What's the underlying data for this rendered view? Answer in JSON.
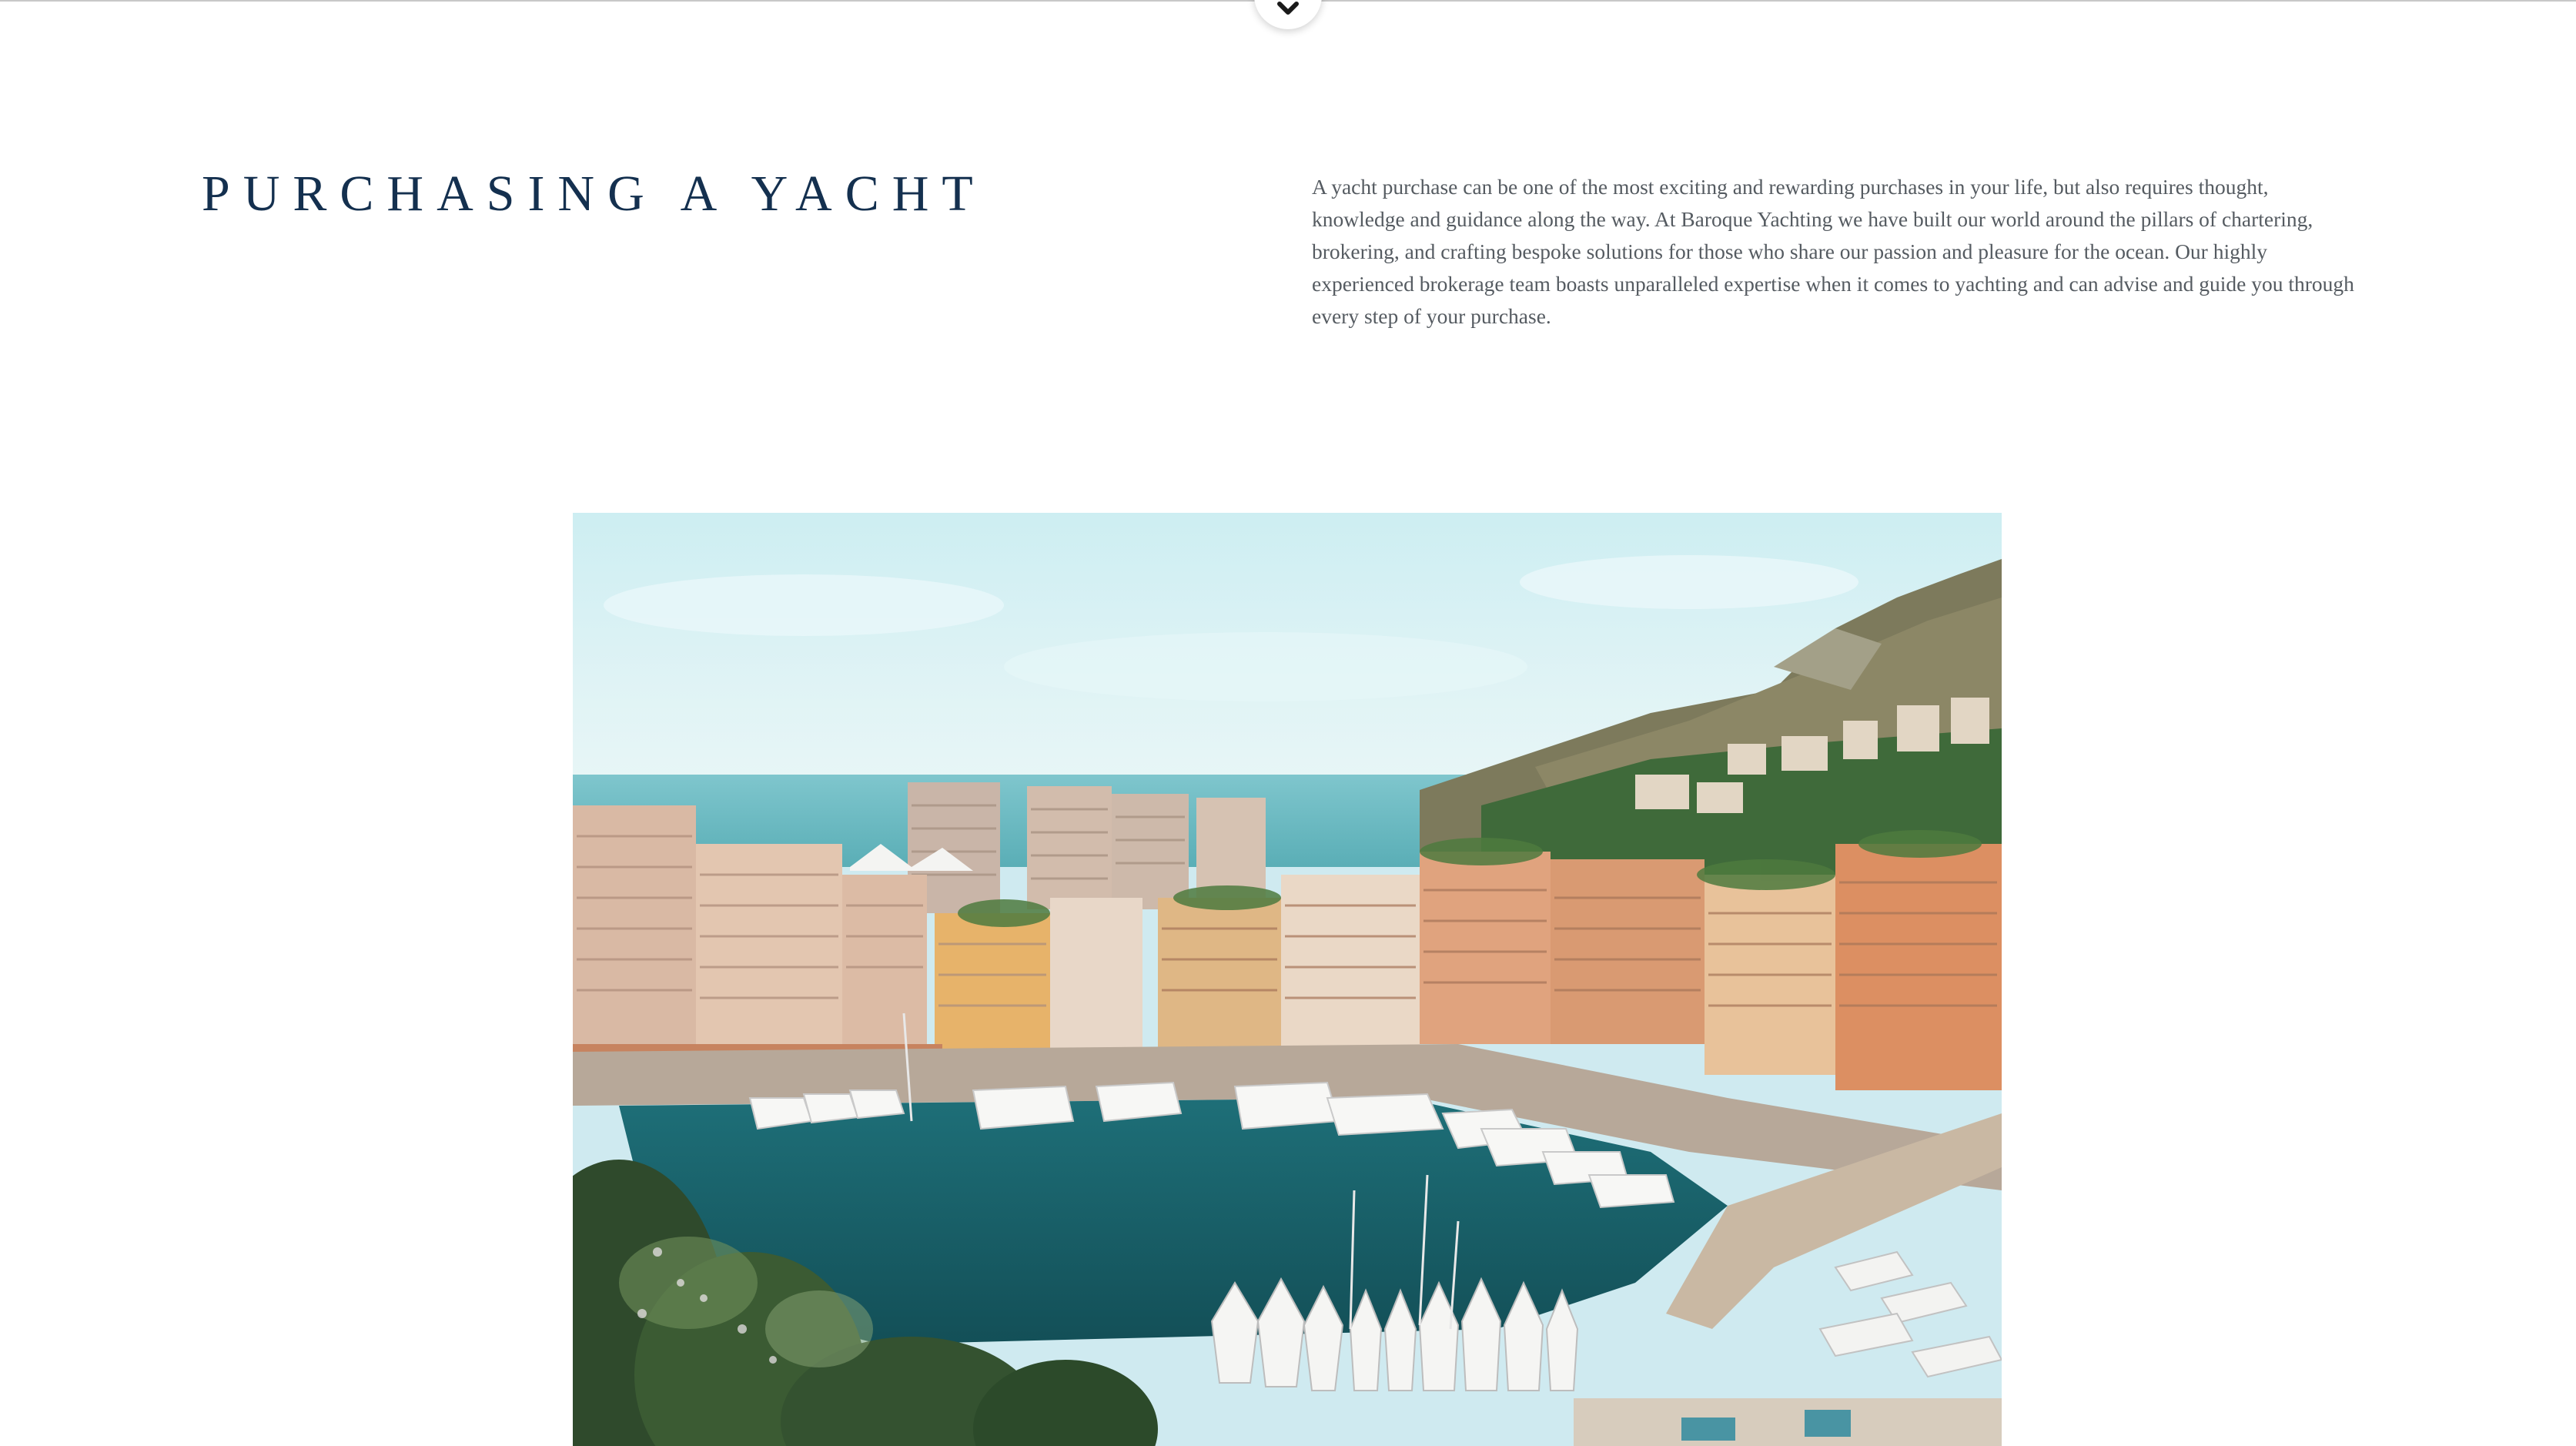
{
  "section": {
    "title": "PURCHASING A YACHT",
    "body": "A yacht purchase can be one of the most exciting and rewarding purchases in your life, but also requires thought, knowledge and guidance along the way. At Baroque Yachting we have built our world around the pillars of chartering, brokering, and crafting bespoke solutions for those who share our passion and pleasure for the ocean. Our highly experienced brokerage team boasts unparalleled expertise when it comes to yachting and can advise and guide you through every step of your purchase."
  },
  "icons": {
    "scroll_down": "chevron-down-icon"
  },
  "colors": {
    "heading": "#14304f",
    "body_text": "#555b61",
    "background": "#ffffff"
  }
}
